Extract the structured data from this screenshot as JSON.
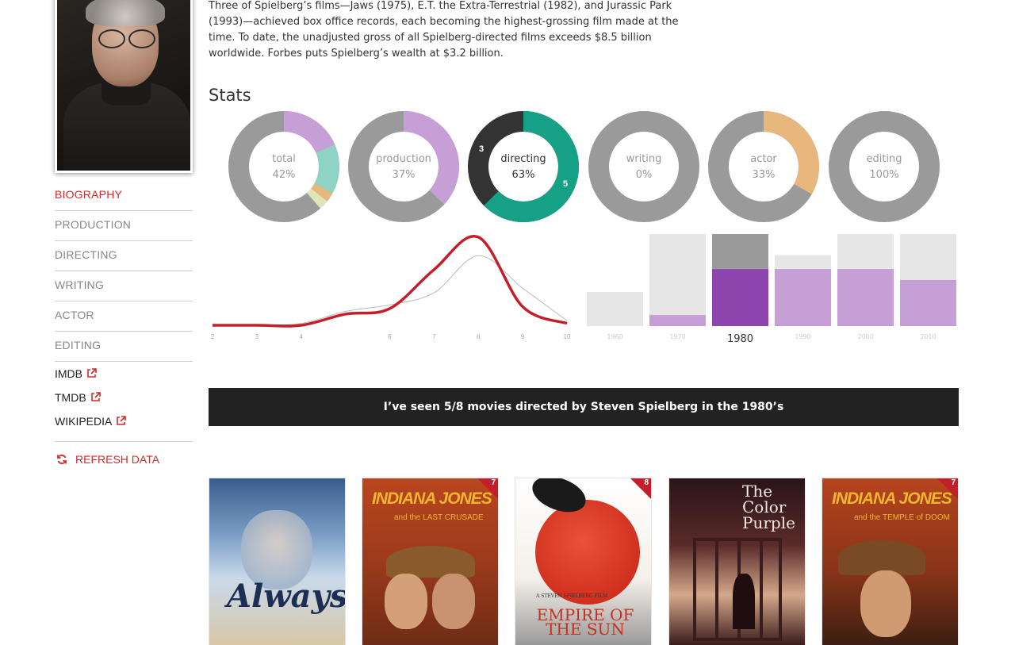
{
  "bio": {
    "lines": [
      "Three of Spielberg’s films—Jaws (1975), E.T. the Extra-Terrestrial (1982), and Jurassic Park",
      "(1993)—achieved box office records, each becoming the highest-grossing film made at the",
      "time. To date, the unadjusted gross of all Spielberg-directed films exceeds $8.5 billion",
      "worldwide. Forbes puts Spielberg’s wealth at $3.2 billion."
    ]
  },
  "nav": {
    "items": [
      {
        "label": "BIOGRAPHY",
        "active": true
      },
      {
        "label": "PRODUCTION",
        "active": false
      },
      {
        "label": "DIRECTING",
        "active": false
      },
      {
        "label": "WRITING",
        "active": false
      },
      {
        "label": "ACTOR",
        "active": false
      },
      {
        "label": "EDITING",
        "active": false
      }
    ],
    "external": [
      "IMDB",
      "TMDB",
      "WIKIPEDIA"
    ],
    "refresh": "REFRESH DATA"
  },
  "stats": {
    "title": "Stats",
    "donuts": [
      {
        "label": "total",
        "pct": "42%"
      },
      {
        "label": "production",
        "pct": "37%"
      },
      {
        "label": "directing",
        "pct": "63%",
        "count_seen": "5",
        "count_unseen": "3"
      },
      {
        "label": "writing",
        "pct": "0%"
      },
      {
        "label": "actor",
        "pct": "33%"
      },
      {
        "label": "editing",
        "pct": "100%"
      }
    ]
  },
  "colors": {
    "accent": "#d32a2a",
    "gray": "#9a9a9a",
    "light_gray": "#e6e6e6",
    "purple": "#c59fd6",
    "dark_purple": "#8e44ad",
    "teal": "#16a085",
    "mint": "#8ed3c3",
    "orange": "#e8b77d",
    "banner": "#222222"
  },
  "chart_data": [
    {
      "type": "line",
      "x_ticks": [
        "2",
        "3",
        "4",
        "6",
        "7",
        "8",
        "9",
        "10"
      ],
      "series": [
        {
          "x": [
            2,
            3,
            4,
            5,
            6,
            7,
            8,
            9,
            10
          ],
          "values": [
            0,
            0,
            0,
            0.12,
            0.18,
            0.6,
            0.95,
            0.2,
            0.02
          ],
          "color": "#c41e2a"
        },
        {
          "x": [
            2,
            3,
            4,
            5,
            6,
            7,
            8,
            9,
            10
          ],
          "values": [
            0,
            0,
            0.02,
            0.15,
            0.22,
            0.35,
            0.75,
            0.4,
            0.05
          ],
          "color": "#bbbbbb"
        }
      ]
    },
    {
      "type": "bar",
      "categories": [
        "1960",
        "1970",
        "1980",
        "1990",
        "2000",
        "2010"
      ],
      "selected": "1980",
      "series": [
        {
          "values": [
            0,
            0.12,
            0.62,
            0.62,
            0.62,
            0.5
          ],
          "color": "#c59fd6"
        },
        {
          "values": [
            0.37,
            0.88,
            0.38,
            0.15,
            0.38,
            0.5
          ],
          "color": "#e6e6e6"
        }
      ]
    }
  ],
  "banner": "I’ve seen 5/8 movies directed by Steven Spielberg in the 1980’s",
  "movies": [
    {
      "title": "Always",
      "rating": ""
    },
    {
      "title": "INDIANA JONES",
      "subtitle": "and the LAST CRUSADE",
      "rating": "7"
    },
    {
      "title": "EMPIRE OF THE SUN",
      "tagline": "A STEVEN SPIELBERG FILM",
      "rating": "8"
    },
    {
      "title": "The Color Purple",
      "rating": ""
    },
    {
      "title": "INDIANA JONES",
      "subtitle": "and the TEMPLE of DOOM",
      "rating": "7"
    }
  ]
}
